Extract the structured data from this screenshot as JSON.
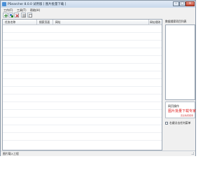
{
  "window": {
    "title": "PSearcher 8.0.0 试用版 [ 图片批量下载 ]",
    "controls": {
      "minimize": "–",
      "maximize": "□",
      "close": "×"
    }
  },
  "menu": {
    "items": [
      "工作(F)",
      "工具(T)",
      "帮助(H)"
    ]
  },
  "toolbar": {
    "buttons": [
      "add-icon",
      "multi-icon",
      "delete-icon",
      "list-icon",
      "settings-icon"
    ]
  },
  "table": {
    "columns": [
      "任务名称",
      "搜索页面",
      "网址",
      "网址规则"
    ]
  },
  "right_panel": {
    "title": "数据搜索项目列表",
    "promo": {
      "line1": "网页操作",
      "line2": "图片批量下载专家",
      "line3": "完全免费使用"
    },
    "checkbox_label": "右键点击任何菜单"
  },
  "status": {
    "text": "图片载入工程"
  },
  "colors": {
    "accent": "#4a8fd6",
    "promo_red": "#e02020",
    "close_red": "#c9472f"
  }
}
